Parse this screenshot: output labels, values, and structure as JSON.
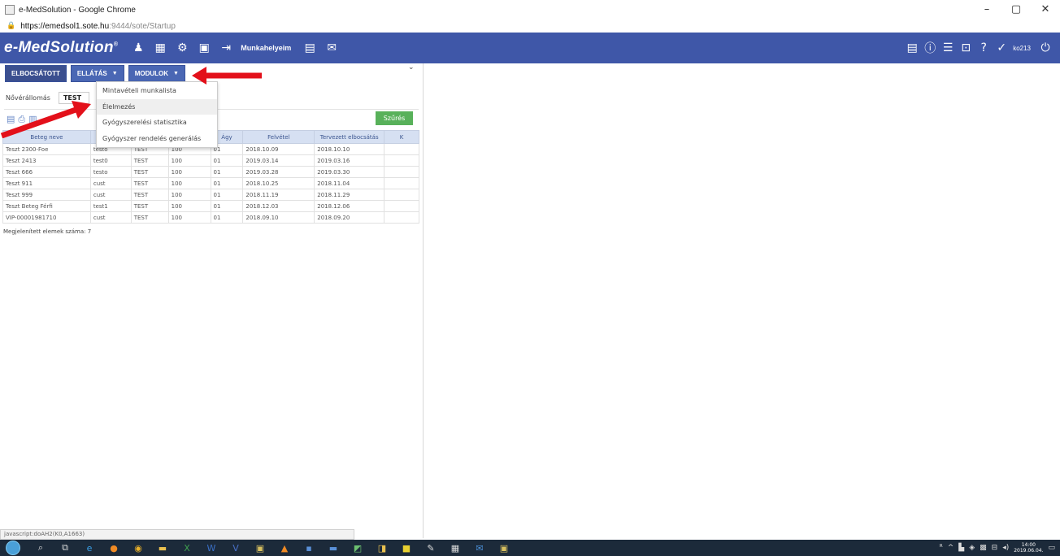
{
  "browser": {
    "tab_title": "e-MedSolution - Google Chrome",
    "url_host": "https://emedsol1.sote.hu",
    "url_path": ":9444/sote/Startup",
    "controls": [
      "–",
      "▢",
      "✕"
    ]
  },
  "header": {
    "logo": "e-MedSolution",
    "logo_mark": "®",
    "workplaces_label": "Munkahelyeim",
    "user": "ko213"
  },
  "nav": {
    "discharged": "ELBOCSÁTOTT",
    "care": "ELLÁTÁS",
    "modules": "MODULOK"
  },
  "dropdown": {
    "items": [
      "Mintavételi munkalista",
      "Élelmezés",
      "Gyógyszerelési statisztika",
      "Gyógyszer rendelés generálás"
    ],
    "highlighted": "Élelmezés"
  },
  "nurse_station": {
    "label": "Nővérállomás",
    "value": "TEST"
  },
  "filter_button": "Szűrés",
  "table": {
    "columns": [
      "Beteg neve",
      "",
      "",
      "",
      "Ágy",
      "Felvétel",
      "Tervezett elbocsátás",
      "K"
    ],
    "rows": [
      [
        "Teszt 2300-Foe",
        "testo",
        "TEST",
        "100",
        "01",
        "2018.10.09",
        "2018.10.10",
        ""
      ],
      [
        "Teszt 2413",
        "test0",
        "TEST",
        "100",
        "01",
        "2019.03.14",
        "2019.03.16",
        ""
      ],
      [
        "Teszt 666",
        "testo",
        "TEST",
        "100",
        "01",
        "2019.03.28",
        "2019.03.30",
        ""
      ],
      [
        "Teszt 911",
        "cust",
        "TEST",
        "100",
        "01",
        "2018.10.25",
        "2018.11.04",
        ""
      ],
      [
        "Teszt 999",
        "cust",
        "TEST",
        "100",
        "01",
        "2018.11.19",
        "2018.11.29",
        ""
      ],
      [
        "Teszt Beteg Férfi",
        "test1",
        "TEST",
        "100",
        "01",
        "2018.12.03",
        "2018.12.06",
        ""
      ],
      [
        "VIP-00001981710",
        "cust",
        "TEST",
        "100",
        "01",
        "2018.09.10",
        "2018.09.20",
        ""
      ]
    ]
  },
  "count_text": "Megjelenített elemek száma: 7",
  "status_text": "javascript:doAH2(K0,A1663)",
  "clock": {
    "time": "14:00",
    "date": "2019.06.04."
  },
  "colors": {
    "header_bg": "#3f57a8",
    "nav_button": "#4a67b4",
    "filter_button": "#58b15a",
    "arrow": "#e3101a"
  }
}
